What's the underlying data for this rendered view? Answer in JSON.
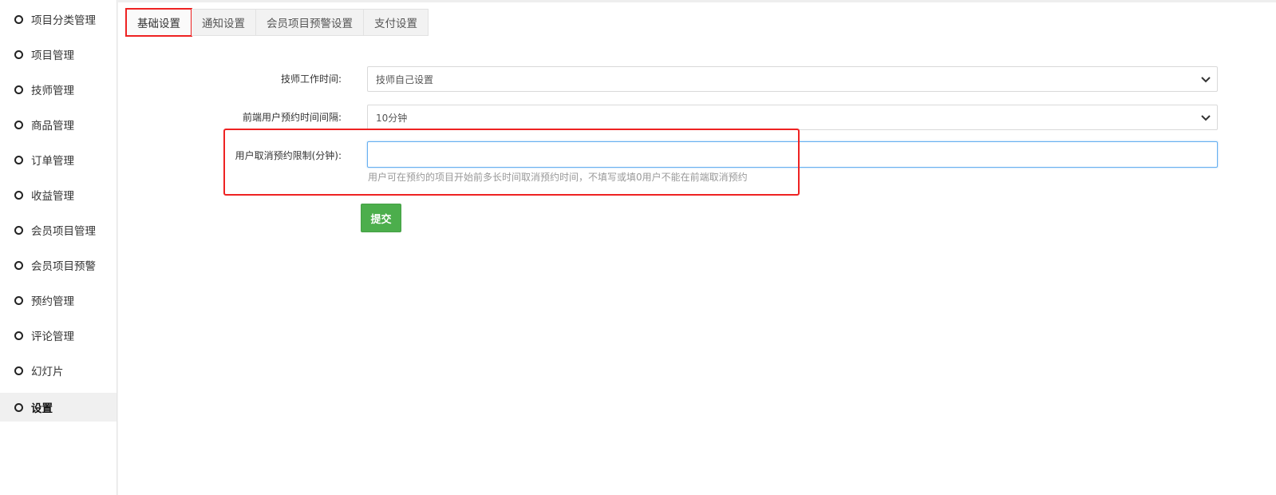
{
  "sidebar": {
    "items": [
      {
        "label": "项目分类管理",
        "active": false
      },
      {
        "label": "项目管理",
        "active": false
      },
      {
        "label": "技师管理",
        "active": false
      },
      {
        "label": "商品管理",
        "active": false
      },
      {
        "label": "订单管理",
        "active": false
      },
      {
        "label": "收益管理",
        "active": false
      },
      {
        "label": "会员项目管理",
        "active": false
      },
      {
        "label": "会员项目预警",
        "active": false
      },
      {
        "label": "预约管理",
        "active": false
      },
      {
        "label": "评论管理",
        "active": false
      },
      {
        "label": "幻灯片",
        "active": false
      },
      {
        "label": "设置",
        "active": true
      }
    ]
  },
  "tabs": [
    {
      "label": "基础设置",
      "active": true
    },
    {
      "label": "通知设置",
      "active": false
    },
    {
      "label": "会员项目预警设置",
      "active": false
    },
    {
      "label": "支付设置",
      "active": false
    }
  ],
  "form": {
    "work_time": {
      "label": "技师工作时间:",
      "value": "技师自己设置"
    },
    "booking_interval": {
      "label": "前端用户预约时间间隔:",
      "value": "10分钟"
    },
    "cancel_limit": {
      "label": "用户取消预约限制(分钟):",
      "value": "",
      "help": "用户可在预约的项目开始前多长时间取消预约时间，不填写或填0用户不能在前端取消预约"
    },
    "submit_label": "提交"
  },
  "colors": {
    "highlight": "#ee2222",
    "submit": "#4cae4c",
    "focus_border": "#66aff0"
  }
}
